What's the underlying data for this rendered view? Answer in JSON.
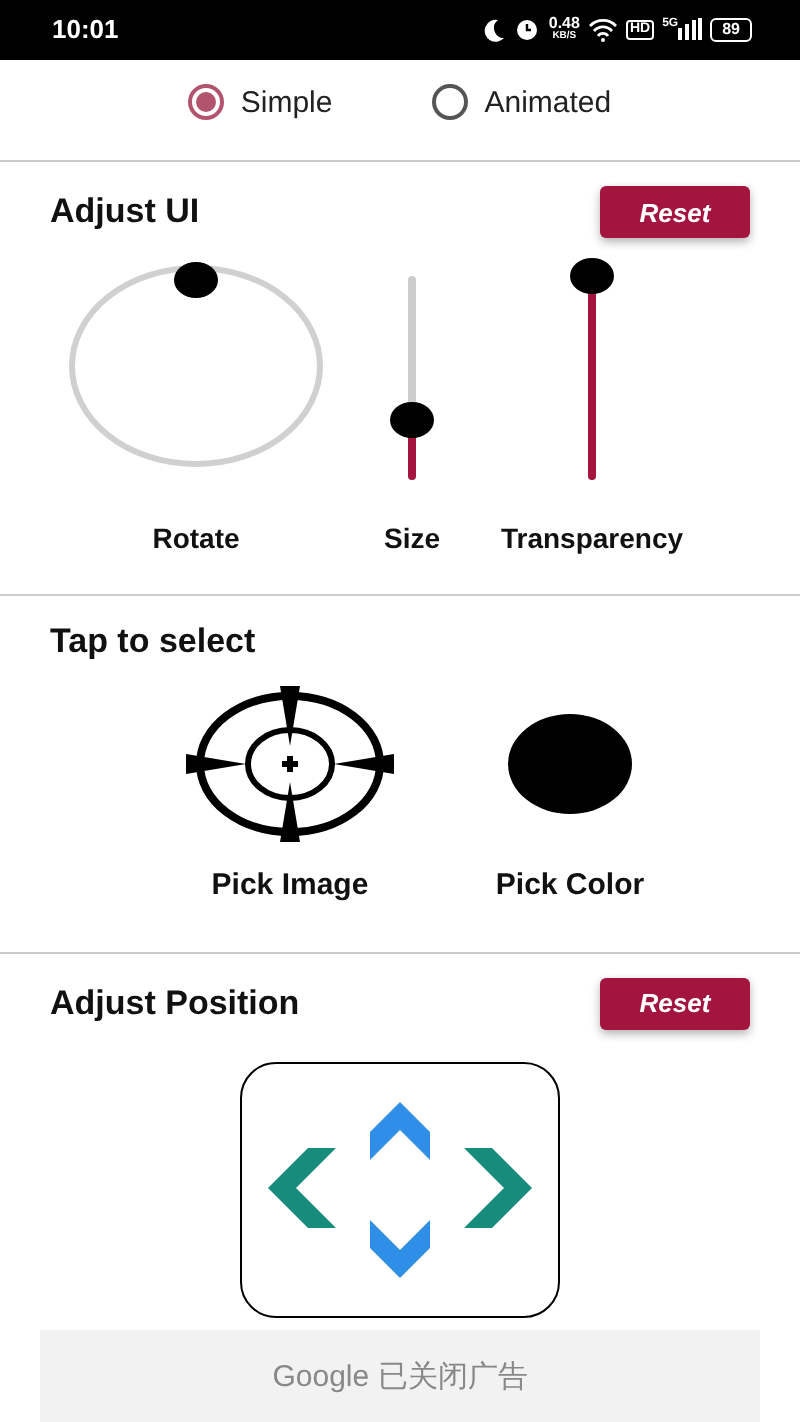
{
  "status_bar": {
    "time": "10:01",
    "speed": "0.48",
    "speed_unit": "KB/S",
    "hd": "HD",
    "network": "5G",
    "battery": "89"
  },
  "mode_options": [
    {
      "label": "Simple",
      "selected": true
    },
    {
      "label": "Animated",
      "selected": false
    }
  ],
  "adjust_ui": {
    "title": "Adjust UI",
    "reset": "Reset",
    "controls": [
      {
        "kind": "dial",
        "label": "Rotate"
      },
      {
        "kind": "vslider",
        "label": "Size",
        "level": 0.3
      },
      {
        "kind": "vslider",
        "label": "Transparency",
        "level": 1
      }
    ]
  },
  "tap_to_select": {
    "title": "Tap to select",
    "items": [
      {
        "kind": "crosshair",
        "label": "Pick Image"
      },
      {
        "kind": "swatch",
        "label": "Pick Color",
        "color": "#000000"
      }
    ]
  },
  "adjust_position": {
    "title": "Adjust Position",
    "reset": "Reset"
  },
  "ad_bar": {
    "text": "Google 已关闭广告"
  }
}
